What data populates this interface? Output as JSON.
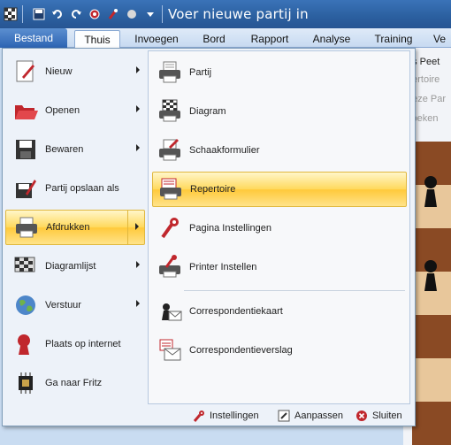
{
  "window": {
    "title": "Voer nieuwe partij in"
  },
  "quick_access": [
    {
      "name": "board-icon",
      "glyph": "▦"
    },
    {
      "name": "save-icon",
      "glyph": "💾"
    },
    {
      "name": "undo-icon",
      "glyph": "↶"
    },
    {
      "name": "redo-icon",
      "glyph": "↷"
    },
    {
      "name": "engine-icon",
      "glyph": "✠"
    },
    {
      "name": "tool-icon",
      "glyph": "⚒"
    },
    {
      "name": "circle-icon",
      "glyph": "●"
    },
    {
      "name": "dropdown-icon",
      "glyph": "▾"
    }
  ],
  "ribbon": {
    "file_tab": "Bestand",
    "tabs": [
      "Thuis",
      "Invoegen",
      "Bord",
      "Rapport",
      "Analyse",
      "Training",
      "Ve"
    ]
  },
  "background": {
    "lines": [
      "ns Peet",
      "pertoire",
      "deze Par",
      "zoeken"
    ]
  },
  "menu": {
    "left_items": [
      {
        "label": "Nieuw",
        "has_submenu": true,
        "icon": "new-icon"
      },
      {
        "label": "Openen",
        "has_submenu": true,
        "icon": "open-folder-icon"
      },
      {
        "label": "Bewaren",
        "has_submenu": true,
        "icon": "save-disk-icon"
      },
      {
        "label": "Partij opslaan als",
        "has_submenu": false,
        "icon": "save-as-icon"
      },
      {
        "label": "Afdrukken",
        "has_submenu": true,
        "icon": "printer-icon"
      },
      {
        "label": "Diagramlijst",
        "has_submenu": true,
        "icon": "diagram-list-icon"
      },
      {
        "label": "Verstuur",
        "has_submenu": true,
        "icon": "globe-icon"
      },
      {
        "label": "Plaats op internet",
        "has_submenu": false,
        "icon": "internet-icon"
      },
      {
        "label": "Ga naar Fritz",
        "has_submenu": false,
        "icon": "chip-icon"
      }
    ],
    "right_items": [
      {
        "label": "Partij",
        "icon": "print-game-icon"
      },
      {
        "label": "Diagram",
        "icon": "print-diagram-icon"
      },
      {
        "label": "Schaakformulier",
        "icon": "scoresheet-icon"
      },
      {
        "label": "Repertoire",
        "icon": "repertoire-icon"
      },
      {
        "label": "Pagina Instellingen",
        "icon": "page-setup-icon"
      },
      {
        "label": "Printer Instellen",
        "icon": "printer-setup-icon"
      },
      {
        "label": "Correspondentiekaart",
        "icon": "correspondence-card-icon"
      },
      {
        "label": "Correspondentieverslag",
        "icon": "correspondence-report-icon"
      }
    ],
    "footer": {
      "settings": "Instellingen",
      "customize": "Aanpassen",
      "close": "Sluiten"
    }
  },
  "colors": {
    "title_bar": "#2b5f9f",
    "highlight": "#ffd95c",
    "file_tab": "#2d64b3"
  }
}
